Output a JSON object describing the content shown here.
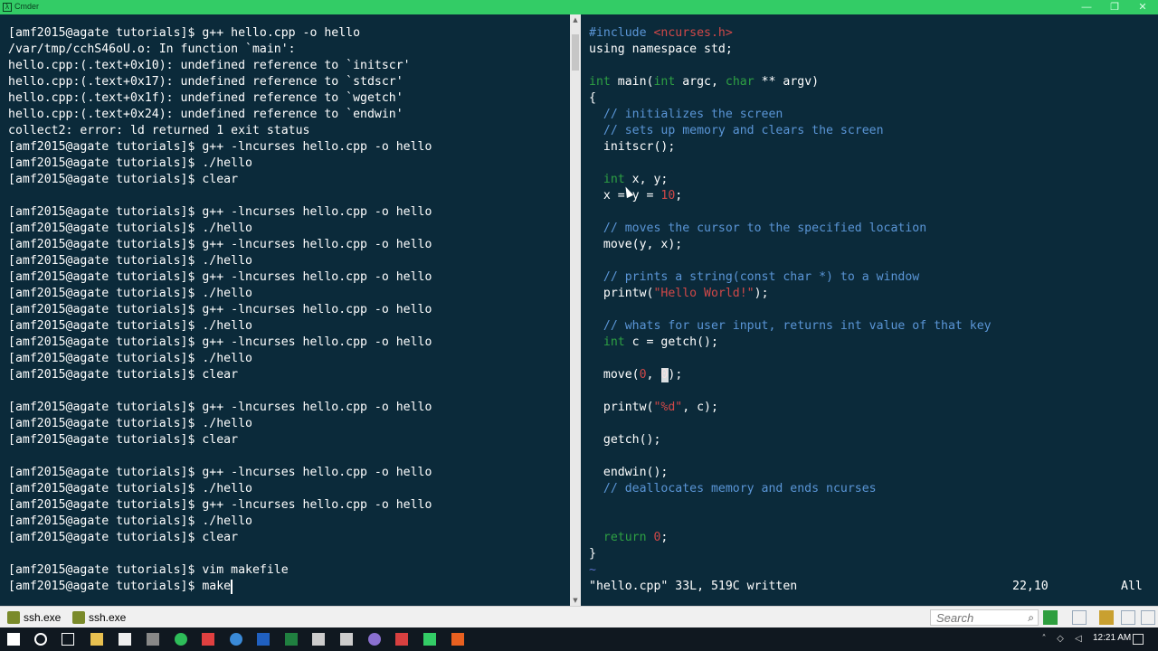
{
  "window": {
    "title": "Cmder",
    "minimize": "—",
    "maximize": "❐",
    "close": "✕"
  },
  "terminal": {
    "lines": [
      "[amf2015@agate tutorials]$ g++ hello.cpp -o hello",
      "/var/tmp/cchS46oU.o: In function `main':",
      "hello.cpp:(.text+0x10): undefined reference to `initscr'",
      "hello.cpp:(.text+0x17): undefined reference to `stdscr'",
      "hello.cpp:(.text+0x1f): undefined reference to `wgetch'",
      "hello.cpp:(.text+0x24): undefined reference to `endwin'",
      "collect2: error: ld returned 1 exit status",
      "[amf2015@agate tutorials]$ g++ -lncurses hello.cpp -o hello",
      "[amf2015@agate tutorials]$ ./hello",
      "[amf2015@agate tutorials]$ clear",
      "",
      "[amf2015@agate tutorials]$ g++ -lncurses hello.cpp -o hello",
      "[amf2015@agate tutorials]$ ./hello",
      "[amf2015@agate tutorials]$ g++ -lncurses hello.cpp -o hello",
      "[amf2015@agate tutorials]$ ./hello",
      "[amf2015@agate tutorials]$ g++ -lncurses hello.cpp -o hello",
      "[amf2015@agate tutorials]$ ./hello",
      "[amf2015@agate tutorials]$ g++ -lncurses hello.cpp -o hello",
      "[amf2015@agate tutorials]$ ./hello",
      "[amf2015@agate tutorials]$ g++ -lncurses hello.cpp -o hello",
      "[amf2015@agate tutorials]$ ./hello",
      "[amf2015@agate tutorials]$ clear",
      "",
      "[amf2015@agate tutorials]$ g++ -lncurses hello.cpp -o hello",
      "[amf2015@agate tutorials]$ ./hello",
      "[amf2015@agate tutorials]$ clear",
      "",
      "[amf2015@agate tutorials]$ g++ -lncurses hello.cpp -o hello",
      "[amf2015@agate tutorials]$ ./hello",
      "[amf2015@agate tutorials]$ g++ -lncurses hello.cpp -o hello",
      "[amf2015@agate tutorials]$ ./hello",
      "[amf2015@agate tutorials]$ clear",
      "",
      "[amf2015@agate tutorials]$ vim makefile",
      "[amf2015@agate tutorials]$ make"
    ]
  },
  "editor": {
    "lines": [
      [
        {
          "t": "#include ",
          "c": "blue"
        },
        {
          "t": "<ncurses.h>",
          "c": "red"
        }
      ],
      [
        {
          "t": "using namespace std;",
          "c": "white"
        }
      ],
      [],
      [
        {
          "t": "int ",
          "c": "green"
        },
        {
          "t": "main(",
          "c": "white"
        },
        {
          "t": "int ",
          "c": "green"
        },
        {
          "t": "argc, ",
          "c": "white"
        },
        {
          "t": "char ",
          "c": "green"
        },
        {
          "t": "** argv)",
          "c": "white"
        }
      ],
      [
        {
          "t": "{",
          "c": "white"
        }
      ],
      [
        {
          "t": "  // initializes the screen",
          "c": "blue"
        }
      ],
      [
        {
          "t": "  // sets up memory and clears the screen",
          "c": "blue"
        }
      ],
      [
        {
          "t": "  initscr();",
          "c": "white"
        }
      ],
      [],
      [
        {
          "t": "  int ",
          "c": "green"
        },
        {
          "t": "x, y;",
          "c": "white"
        }
      ],
      [
        {
          "t": "  x = y = ",
          "c": "white"
        },
        {
          "t": "10",
          "c": "red"
        },
        {
          "t": ";",
          "c": "white"
        }
      ],
      [],
      [
        {
          "t": "  // moves the cursor to the specified location",
          "c": "blue"
        }
      ],
      [
        {
          "t": "  move(y, x);",
          "c": "white"
        }
      ],
      [],
      [
        {
          "t": "  // prints a string(const char *) to a window",
          "c": "blue"
        }
      ],
      [
        {
          "t": "  printw(",
          "c": "white"
        },
        {
          "t": "\"Hello World!\"",
          "c": "red"
        },
        {
          "t": ");",
          "c": "white"
        }
      ],
      [],
      [
        {
          "t": "  // whats for user input, returns int value of that key",
          "c": "blue"
        }
      ],
      [
        {
          "t": "  int ",
          "c": "green"
        },
        {
          "t": "c = getch();",
          "c": "white"
        }
      ],
      [],
      [
        {
          "t": "  move(",
          "c": "white"
        },
        {
          "t": "0",
          "c": "red"
        },
        {
          "t": ", ",
          "c": "white"
        },
        {
          "t": "0",
          "c": "red"
        },
        {
          "t": ");",
          "c": "white"
        }
      ],
      [],
      [
        {
          "t": "  printw(",
          "c": "white"
        },
        {
          "t": "\"%d\"",
          "c": "red"
        },
        {
          "t": ", c);",
          "c": "white"
        }
      ],
      [],
      [
        {
          "t": "  getch();",
          "c": "white"
        }
      ],
      [],
      [
        {
          "t": "  endwin();",
          "c": "white"
        }
      ],
      [
        {
          "t": "  // deallocates memory and ends ncurses",
          "c": "blue"
        }
      ],
      [],
      [],
      [
        {
          "t": "  return ",
          "c": "green"
        },
        {
          "t": "0",
          "c": "red"
        },
        {
          "t": ";",
          "c": "white"
        }
      ],
      [
        {
          "t": "}",
          "c": "white"
        }
      ],
      [
        {
          "t": "~",
          "c": "tilde"
        }
      ]
    ],
    "status_left": "\"hello.cpp\" 33L, 519C written",
    "status_pos": "22,10",
    "status_all": "All"
  },
  "tabs": [
    {
      "label": "ssh.exe",
      "icon": "console-icon"
    },
    {
      "label": "ssh.exe",
      "icon": "console-icon"
    }
  ],
  "search": {
    "placeholder": "Search"
  },
  "taskbar": {
    "time": "12:21 AM"
  },
  "colors": {
    "titlebar": "#33cc66",
    "background": "#0b2a3a",
    "comment": "#5a95d6",
    "keyword": "#2ea043",
    "string": "#d04848"
  }
}
